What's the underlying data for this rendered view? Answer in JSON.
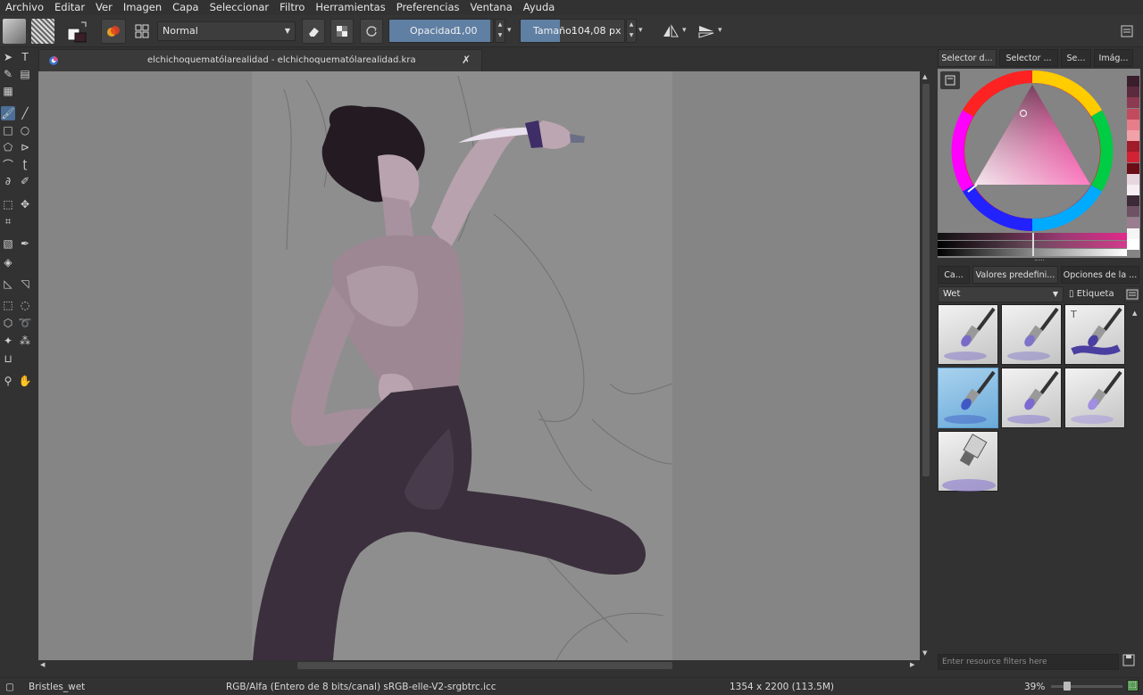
{
  "menu": [
    "Archivo",
    "Editar",
    "Ver",
    "Imagen",
    "Capa",
    "Seleccionar",
    "Filtro",
    "Herramientas",
    "Preferencias",
    "Ventana",
    "Ayuda"
  ],
  "options": {
    "blend_mode": "Normal",
    "opacity_label": "Opacidad:",
    "opacity_value": "1,00",
    "opacity_fraction": 0.97,
    "size_label": "Tamaño:",
    "size_value": "104,08 px",
    "size_fraction": 0.38
  },
  "document": {
    "tab_title": "elchichoquematólarealidad - elchichoquematólarealidad.kra"
  },
  "dock": {
    "top_tabs": [
      "Selector d...",
      "Selector ...",
      "Se...",
      "Imág..."
    ],
    "color": {
      "hue_color": "#e8008a",
      "palette": [
        "#3a1e2c",
        "#5c2a3d",
        "#8c3a52",
        "#c24a5e",
        "#e87d8a",
        "#f2a1a8",
        "#a01c2a",
        "#d22234",
        "#6a0d17",
        "#e8d6de",
        "#f6eef2",
        "#3c2a36",
        "#6e5164",
        "#9a7d90",
        "#f5f5f5",
        "#ffffff"
      ]
    },
    "bottom_tabs": [
      "Ca...",
      "Valores predefini...",
      "Opciones de la ..."
    ],
    "tag_filter": "Wet",
    "tag_button": "Etiqueta",
    "presets_count": 7,
    "active_preset_index": 3,
    "search_placeholder": "Enter resource filters here"
  },
  "status": {
    "brush_name": "Bristles_wet",
    "color_info": "RGB/Alfa (Entero de 8 bits/canal)  sRGB-elle-V2-srgbtrc.icc",
    "image_size": "1354 x 2200 (113.5M)",
    "zoom": "39%",
    "zoom_fraction": 0.2
  }
}
